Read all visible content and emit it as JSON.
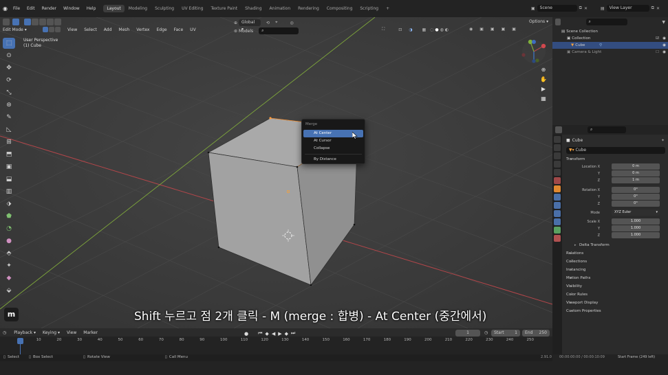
{
  "top_menu": [
    "File",
    "Edit",
    "Render",
    "Window",
    "Help"
  ],
  "workspace_tabs": [
    {
      "label": "Layout",
      "active": true
    },
    {
      "label": "Modeling",
      "active": false
    },
    {
      "label": "Sculpting",
      "active": false
    },
    {
      "label": "UV Editing",
      "active": false
    },
    {
      "label": "Texture Paint",
      "active": false
    },
    {
      "label": "Shading",
      "active": false
    },
    {
      "label": "Animation",
      "active": false
    },
    {
      "label": "Rendering",
      "active": false
    },
    {
      "label": "Compositing",
      "active": false
    },
    {
      "label": "Scripting",
      "active": false
    }
  ],
  "add_workspace": "+",
  "scene_name": "Scene",
  "view_layer": "View Layer",
  "viewport": {
    "mode": "Edit Mode",
    "menus": [
      "View",
      "Select",
      "Add",
      "Mesh",
      "Vertex",
      "Edge",
      "Face",
      "UV"
    ],
    "transform_orientation": "Global",
    "models_label": "Models",
    "options_label": "Options",
    "info_line1": "User Perspective",
    "info_line2": "(1) Cube"
  },
  "merge_menu": {
    "title": "Merge",
    "items": [
      "At Center",
      "At Cursor",
      "Collapse",
      "By Distance"
    ],
    "highlighted": "At Center"
  },
  "subtitle": "Shift 누르고 점 2개 클릭 - M (merge : 합병) - At Center (중간에서)",
  "outliner": {
    "rows": [
      {
        "label": "Scene Collection",
        "selected": false
      },
      {
        "label": "Collection",
        "selected": false
      },
      {
        "label": "Cube",
        "selected": true
      },
      {
        "label": "Camera & Light",
        "selected": false
      }
    ]
  },
  "properties": {
    "object_name": "Cube",
    "data_name": "Cube",
    "transform_label": "Transform",
    "location": [
      {
        "axis": "Location X",
        "value": "0 m"
      },
      {
        "axis": "Y",
        "value": "0 m"
      },
      {
        "axis": "Z",
        "value": "1 m"
      }
    ],
    "rotation": [
      {
        "axis": "Rotation X",
        "value": "0°"
      },
      {
        "axis": "Y",
        "value": "0°"
      },
      {
        "axis": "Z",
        "value": "0°"
      }
    ],
    "mode_label": "Mode",
    "mode_value": "XYZ Euler",
    "scale": [
      {
        "axis": "Scale X",
        "value": "1.000"
      },
      {
        "axis": "Y",
        "value": "1.000"
      },
      {
        "axis": "Z",
        "value": "1.000"
      }
    ],
    "panels": [
      "Delta Transform",
      "Relations",
      "Collections",
      "Instancing",
      "Motion Paths",
      "Visibility",
      "Color Rules",
      "Viewport Display",
      "Custom Properties"
    ]
  },
  "timeline": {
    "menus": [
      "Playback",
      "Keying",
      "View",
      "Marker"
    ],
    "current_frame": "1",
    "start_label": "Start",
    "start_value": "1",
    "end_label": "End",
    "end_value": "250",
    "ticks": [
      "1",
      "10",
      "20",
      "30",
      "40",
      "50",
      "60",
      "70",
      "80",
      "90",
      "100",
      "110",
      "120",
      "130",
      "140",
      "150",
      "160",
      "170",
      "180",
      "190",
      "200",
      "210",
      "220",
      "230",
      "240",
      "250"
    ]
  },
  "status_bar": {
    "select": "Select",
    "box_select": "Box Select",
    "rotate_view": "Rotate View",
    "call_menu": "Call Menu",
    "version": "2.91.0",
    "time": "00:00:00:00 / 00:00:10:09",
    "frame_info": "Start Frame (249 left)"
  },
  "icons": {
    "blender_logo": "blender-icon",
    "watermark": "m"
  },
  "colors": {
    "accent": "#4772b3",
    "viewport_bg": "#3c3c3c",
    "x_axis": "#b3464a",
    "y_axis": "#7fa83b"
  }
}
